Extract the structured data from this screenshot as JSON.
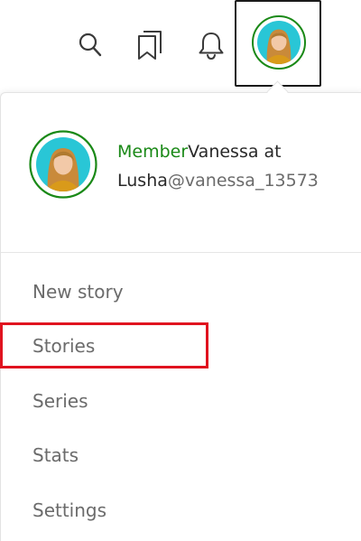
{
  "header": {
    "icons": [
      "search-icon",
      "bookmark-icon",
      "bell-icon",
      "avatar"
    ]
  },
  "profile": {
    "badge": "Member",
    "name": "Vanessa at Lusha",
    "handle": "@vanessa_13573"
  },
  "menu": {
    "items": [
      {
        "label": "New story"
      },
      {
        "label": "Stories"
      },
      {
        "label": "Series"
      },
      {
        "label": "Stats"
      },
      {
        "label": "Settings"
      }
    ],
    "highlighted": "Stories"
  },
  "colors": {
    "member_green": "#1a8917",
    "avatar_ring": "#1a8917",
    "avatar_bg": "#29c6d6",
    "highlight_red": "#e0131f"
  }
}
